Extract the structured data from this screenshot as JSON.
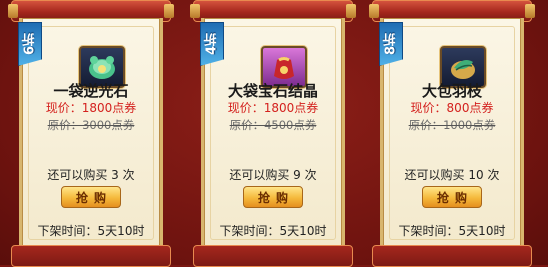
{
  "cards": [
    {
      "discount": "6折",
      "icon": "gem-icon",
      "name": "一袋逆光石",
      "price_now": "现价：1800点券",
      "price_old": "原价：3000点券",
      "remain": "还可以购买 3 次",
      "buy_label": "抢购",
      "offline": "下架时间：5天10时"
    },
    {
      "discount": "4折",
      "icon": "bag-icon",
      "name": "大袋宝石结晶",
      "price_now": "现价：1800点券",
      "price_old": "原价：4500点券",
      "remain": "还可以购买 9 次",
      "buy_label": "抢购",
      "offline": "下架时间：5天10时"
    },
    {
      "discount": "8折",
      "icon": "feather-icon",
      "name": "大包羽枝",
      "price_now": "现价：800点券",
      "price_old": "原价：1000点券",
      "remain": "还可以购买 10 次",
      "buy_label": "抢购",
      "offline": "下架时间：5天10时"
    }
  ],
  "colors": {
    "ribbon": "#1f6db3",
    "price_now": "#d4211e",
    "button": "#f5b93b",
    "background": "#7a1712"
  }
}
